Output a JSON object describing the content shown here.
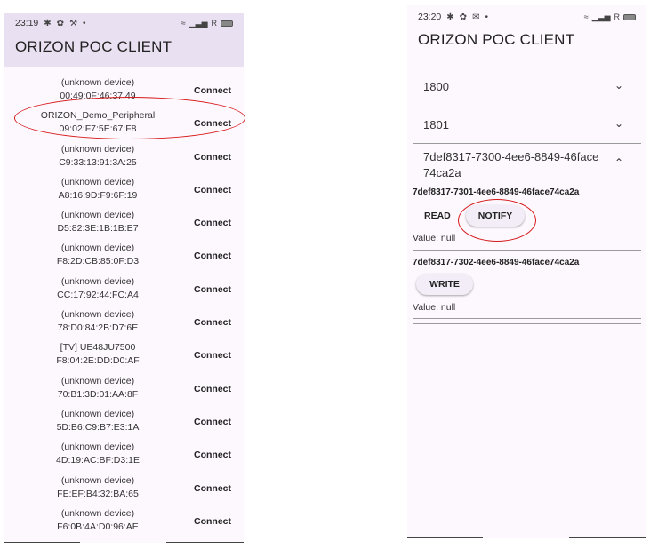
{
  "left": {
    "status_time": "23:19",
    "status_icons": [
      "bluetooth-icon",
      "gear-icon",
      "wrench-icon",
      "dot-icon"
    ],
    "status_right": "R",
    "title": "ORIZON POC CLIENT",
    "devices": [
      {
        "name": "(unknown device)",
        "address": "00:49:0F:46:37:49",
        "connect": "Connect"
      },
      {
        "name": "ORIZON_Demo_Peripheral",
        "address": "09:02:F7:5E:67:F8",
        "connect": "Connect"
      },
      {
        "name": "(unknown device)",
        "address": "C9:33:13:91:3A:25",
        "connect": "Connect"
      },
      {
        "name": "(unknown device)",
        "address": "A8:16:9D:F9:6F:19",
        "connect": "Connect"
      },
      {
        "name": "(unknown device)",
        "address": "D5:82:3E:1B:1B:E7",
        "connect": "Connect"
      },
      {
        "name": "(unknown device)",
        "address": "F8:2D:CB:85:0F:D3",
        "connect": "Connect"
      },
      {
        "name": "(unknown device)",
        "address": "CC:17:92:44:FC:A4",
        "connect": "Connect"
      },
      {
        "name": "(unknown device)",
        "address": "78:D0:84:2B:D7:6E",
        "connect": "Connect"
      },
      {
        "name": "[TV] UE48JU7500",
        "address": "F8:04:2E:DD:D0:AF",
        "connect": "Connect"
      },
      {
        "name": "(unknown device)",
        "address": "70:B1:3D:01:AA:8F",
        "connect": "Connect"
      },
      {
        "name": "(unknown device)",
        "address": "5D:B6:C9:B7:E3:1A",
        "connect": "Connect"
      },
      {
        "name": "(unknown device)",
        "address": "4D:19:AC:BF:D3:1E",
        "connect": "Connect"
      },
      {
        "name": "(unknown device)",
        "address": "FE:EF:B4:32:BA:65",
        "connect": "Connect"
      },
      {
        "name": "(unknown device)",
        "address": "F6:0B:4A:D0:96:AE",
        "connect": "Connect"
      }
    ]
  },
  "right": {
    "status_time": "23:20",
    "status_icons": [
      "bluetooth-icon",
      "gear-icon",
      "mail-icon",
      "dot-icon"
    ],
    "status_right": "R",
    "title": "ORIZON POC CLIENT",
    "services": [
      {
        "uuid": "1800",
        "expanded": false
      },
      {
        "uuid": "1801",
        "expanded": false
      },
      {
        "uuid_line1": "7def8317-7300-4ee6-8849-46face",
        "uuid_line2": "74ca2a",
        "expanded": true
      }
    ],
    "characteristics": [
      {
        "uuid": "7def8317-7301-4ee6-8849-46face74ca2a",
        "read_label": "READ",
        "notify_label": "NOTIFY",
        "value": "Value: null"
      },
      {
        "uuid": "7def8317-7302-4ee6-8849-46face74ca2a",
        "write_label": "WRITE",
        "value": "Value: null"
      }
    ]
  },
  "colors": {
    "annotation": "#d61a1a",
    "appbar": "#e9e0f1",
    "background": "#fdf7fe"
  }
}
